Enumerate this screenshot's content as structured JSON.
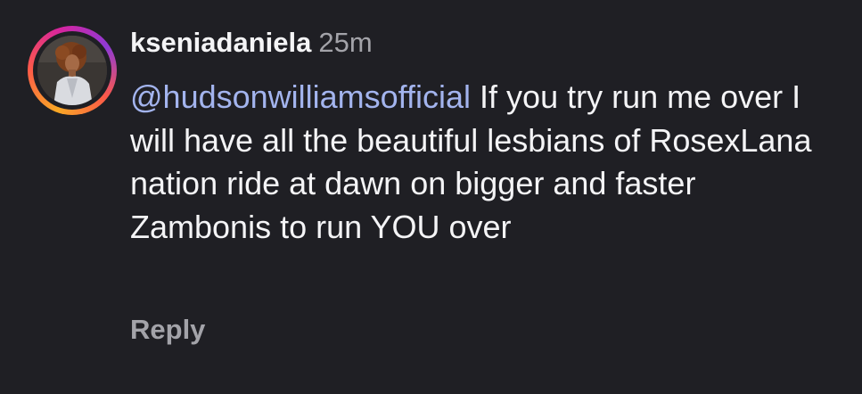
{
  "comment": {
    "username": "kseniadaniela",
    "timestamp": "25m",
    "mention": "@hudsonwilliamsofficial",
    "text": " If you try run me over I will have all the beautiful lesbians of RosexLana nation ride at dawn on bigger and faster Zambonis to run YOU over",
    "reply_label": "Reply"
  },
  "colors": {
    "background": "#1f1f24",
    "text": "#f4f4f6",
    "muted": "#a3a3a9",
    "mention": "#a3b4ee"
  }
}
